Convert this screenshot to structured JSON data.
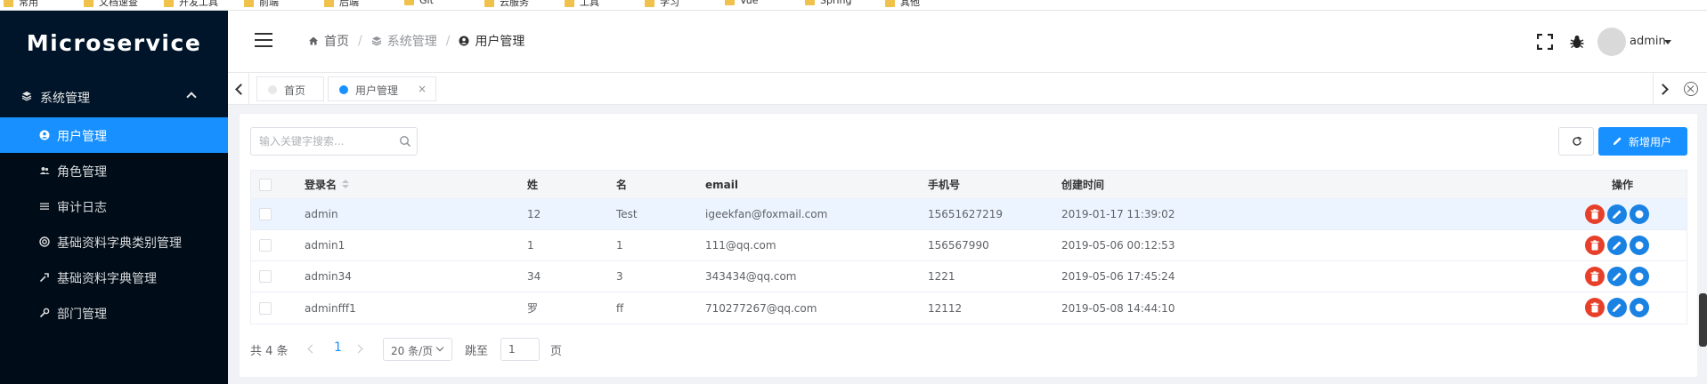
{
  "app": {
    "logo": "Microservice",
    "accent": "#1890ff",
    "sidebar_bg": "#001529"
  },
  "bookmarks": [
    "常用",
    "文档速查",
    "开发工具",
    "前端",
    "后端",
    "Git",
    "云服务",
    "工具",
    "学习",
    "Vue",
    "Spring",
    "其他"
  ],
  "sidebar": {
    "group": {
      "label": "系统管理",
      "icon": "layers-icon"
    },
    "items": [
      {
        "label": "用户管理",
        "icon": "user-circle-icon",
        "active": true
      },
      {
        "label": "角色管理",
        "icon": "users-icon",
        "active": false
      },
      {
        "label": "审计日志",
        "icon": "list-icon",
        "active": false
      },
      {
        "label": "基础资料字典类别管理",
        "icon": "settings-icon",
        "active": false
      },
      {
        "label": "基础资料字典管理",
        "icon": "wrench-icon",
        "active": false
      },
      {
        "label": "部门管理",
        "icon": "tool-icon",
        "active": false
      }
    ]
  },
  "header": {
    "breadcrumb": [
      {
        "label": "首页",
        "icon": "home-icon"
      },
      {
        "label": "系统管理",
        "icon": "layers-icon"
      },
      {
        "label": "用户管理",
        "icon": "user-circle-icon"
      }
    ],
    "username": "admin"
  },
  "tags": [
    {
      "label": "首页",
      "active": false
    },
    {
      "label": "用户管理",
      "active": true,
      "close": "×"
    }
  ],
  "toolbar": {
    "search_placeholder": "输入关键字搜索...",
    "add_label": "新增用户"
  },
  "table": {
    "columns": [
      "登录名",
      "姓",
      "名",
      "email",
      "手机号",
      "创建时间",
      "操作"
    ],
    "rows": [
      {
        "login": "admin",
        "last": "12",
        "first": "Test",
        "email": "igeekfan@foxmail.com",
        "phone": "15651627219",
        "created": "2019-01-17 11:39:02"
      },
      {
        "login": "admin1",
        "last": "1",
        "first": "1",
        "email": "111@qq.com",
        "phone": "156567990",
        "created": "2019-05-06 00:12:53"
      },
      {
        "login": "admin34",
        "last": "34",
        "first": "3",
        "email": "343434@qq.com",
        "phone": "1221",
        "created": "2019-05-06 17:45:24"
      },
      {
        "login": "adminfff1",
        "last": "罗",
        "first": "ff",
        "email": "710277267@qq.com",
        "phone": "12112",
        "created": "2019-05-08 14:44:10"
      }
    ]
  },
  "pagination": {
    "total": "共 4 条",
    "current": "1",
    "page_size": "20 条/页",
    "goto_label": "跳至",
    "goto_value": "1",
    "page_suffix": "页"
  }
}
